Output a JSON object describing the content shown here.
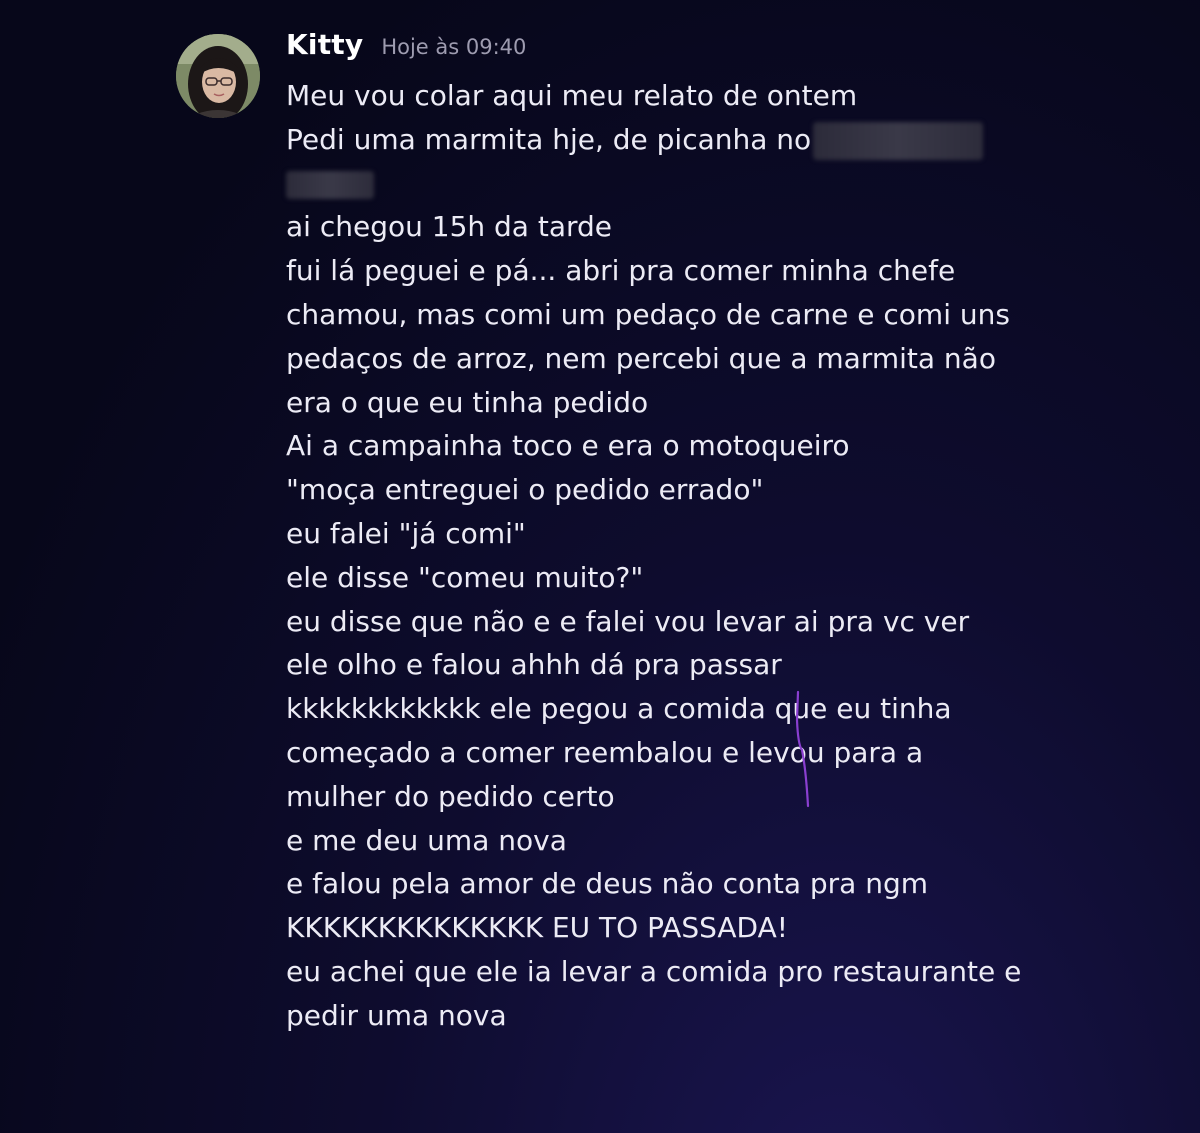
{
  "message": {
    "username": "Kitty",
    "timestamp": "Hoje às 09:40",
    "line1": "Meu vou colar aqui meu relato de ontem",
    "line2": "Pedi uma marmita hje, de picanha no",
    "line3": "ai chegou 15h da tarde",
    "line4": "fui lá peguei e pá... abri pra comer minha chefe",
    "line5": "chamou, mas comi um pedaço de carne e comi uns",
    "line6": "pedaços de arroz, nem percebi que a marmita não",
    "line7": "era o que eu tinha pedido",
    "line8": "Ai a campainha toco e era o motoqueiro",
    "line9": "\"moça entreguei o pedido errado\"",
    "line10": "eu falei \"já comi\"",
    "line11": "ele disse \"comeu muito?\"",
    "line12": "eu disse que não e e falei vou levar ai pra vc ver",
    "line13": "ele olho e falou ahhh dá pra passar",
    "line14": "kkkkkkkkkkkk ele pegou a comida que eu tinha",
    "line15": "começado a comer reembalou e levou para a",
    "line16": "mulher do pedido certo",
    "line17": "e me deu uma nova",
    "line18": "e falou pela amor de deus não conta pra ngm",
    "line19": "KKKKKKKKKKKKKK EU TO PASSADA!",
    "line20": "eu achei que ele ia levar a comida pro restaurante e",
    "line21": "pedir uma nova"
  },
  "colors": {
    "background": "#0b0a22",
    "text": "#ecebf5",
    "username": "#ffffff",
    "timestamp": "#9e9cb0",
    "pen_mark": "#8a3fd0"
  }
}
